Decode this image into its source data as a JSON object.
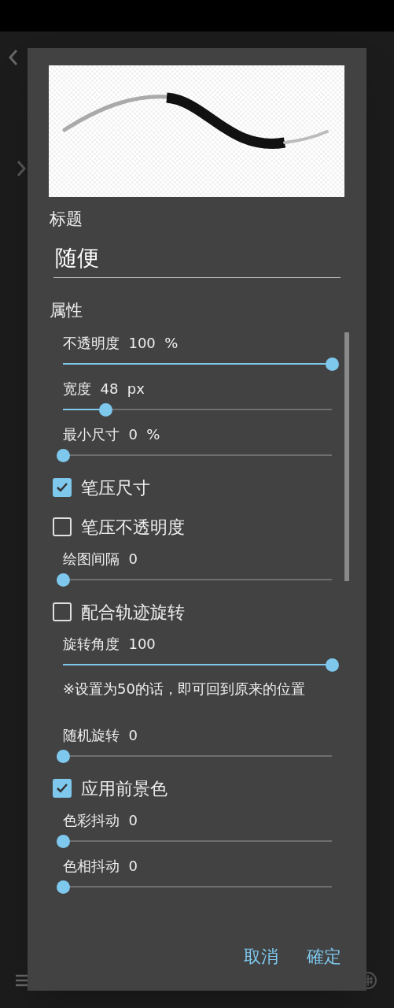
{
  "dialog": {
    "title_label": "标题",
    "title_value": "随便",
    "section_label": "属性",
    "items": [
      {
        "kind": "slider",
        "label": "不透明度  100  %",
        "level": 1
      },
      {
        "kind": "slider",
        "label": "宽度  48  px",
        "level": 0.158
      },
      {
        "kind": "slider",
        "label": "最小尺寸  0  %",
        "level": 0
      },
      {
        "kind": "checkbox",
        "label": "笔压尺寸",
        "checked": true
      },
      {
        "kind": "checkbox",
        "label": "笔压不透明度",
        "checked": false
      },
      {
        "kind": "slider",
        "label": "绘图间隔  0",
        "level": 0
      },
      {
        "kind": "checkbox",
        "label": "配合轨迹旋转",
        "checked": false
      },
      {
        "kind": "slider",
        "label": "旋转角度  100",
        "level": 1
      },
      {
        "kind": "note",
        "label": "※设置为50的话，即可回到原来的位置"
      },
      {
        "kind": "slider",
        "label": "随机旋转  0",
        "level": 0
      },
      {
        "kind": "checkbox",
        "label": "应用前景色",
        "checked": true
      },
      {
        "kind": "slider",
        "label": "色彩抖动  0",
        "level": 0
      },
      {
        "kind": "slider",
        "label": "色相抖动  0",
        "level": 0
      }
    ],
    "buttons": [
      "取消",
      "確定"
    ]
  }
}
